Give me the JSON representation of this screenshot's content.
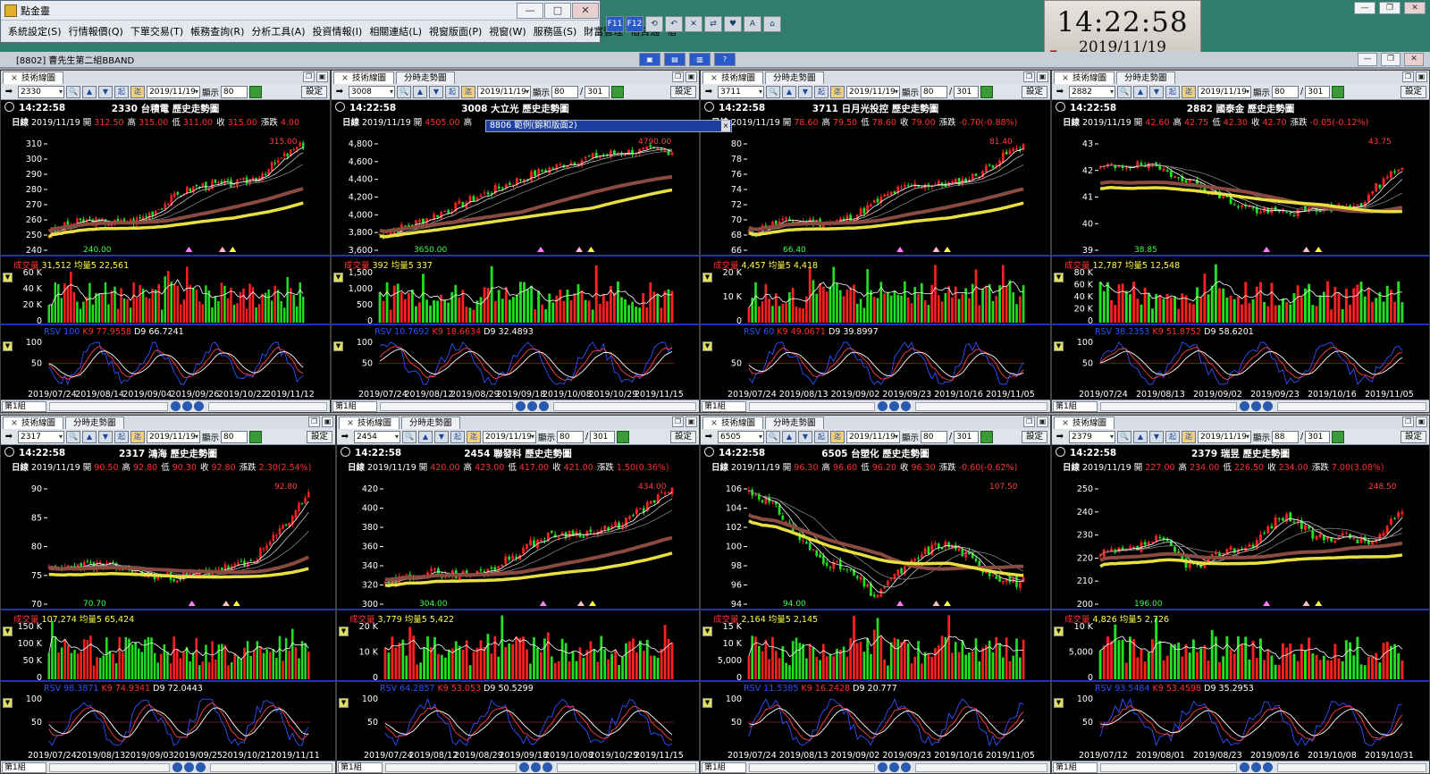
{
  "window": {
    "title": "點金靈",
    "menu": [
      "系統設定(S)",
      "行情報價(Q)",
      "下單交易(T)",
      "帳務查詢(R)",
      "分析工具(A)",
      "投資情報(I)",
      "相關連結(L)",
      "視窗版面(P)",
      "視窗(W)",
      "服務區(S)",
      "財富管理",
      "借貸通",
      "借"
    ],
    "subtitle": "[8802] 曹先生第二組BBAND",
    "toolbar_icons": [
      "F11",
      "F12"
    ],
    "layout_icons": [
      "layout-a",
      "layout-b",
      "layout-c",
      "help"
    ]
  },
  "clock": {
    "time": "14:22:58",
    "date": "2019/11/19"
  },
  "popup": {
    "text": "8806 範例(錦和版面2)"
  },
  "panels": [
    {
      "tab1": "技術線圖",
      "tab2": "",
      "code": "2330",
      "date": "2019/11/19",
      "display_label": "顯示",
      "display": "80",
      "total": "",
      "set": "設定",
      "time": "14:22:58",
      "name": "2330 台積電  歷史走勢圖",
      "dline": {
        "k": "日線",
        "date": "2019/11/19",
        "open_lbl": "開",
        "open": "312.50",
        "high_lbl": "高",
        "high": "315.00",
        "low_lbl": "低",
        "low": "311.00",
        "close_lbl": "收",
        "close": "315.00",
        "chg_lbl": "漲跌",
        "chg": "4.00"
      },
      "price_ticks": [
        "310",
        "300",
        "290",
        "280",
        "270",
        "260",
        "250",
        "240"
      ],
      "price_range": [
        238,
        315
      ],
      "lo_label": "240.00",
      "hi_label": "315.00",
      "vol": {
        "lbl": "成交量",
        "v": "31,512",
        "avg_lbl": "均量5",
        "avg": "22,561",
        "ticks": [
          "60 K",
          "40 K",
          "20 K",
          "0"
        ]
      },
      "kd": {
        "rsv_lbl": "RSV",
        "rsv": "100",
        "k_lbl": "K9",
        "k": "77.9558",
        "d_lbl": "D9",
        "d": "66.7241",
        "ticks": [
          "100",
          "50"
        ]
      },
      "dates": [
        "2019/07/24",
        "2019/08/14",
        "2019/09/04",
        "2019/09/26",
        "2019/10/22",
        "2019/11/12"
      ],
      "group": "第1組",
      "trend": 1,
      "seed": 3
    },
    {
      "tab1": "技術線圖",
      "tab2": "分時走勢圖",
      "code": "3008",
      "date": "2019/11/19",
      "display_label": "顯示",
      "display": "80",
      "total": "301",
      "set": "設定",
      "time": "14:22:58",
      "name": "3008 大立光  歷史走勢圖",
      "dline": {
        "k": "日線",
        "date": "2019/11/19",
        "open_lbl": "開",
        "open": "4505.00",
        "high_lbl": "高",
        "high": "",
        "low_lbl": "",
        "low": "",
        "close_lbl": "",
        "close": "",
        "chg_lbl": "",
        "chg": ""
      },
      "price_ticks": [
        "4,800",
        "4,600",
        "4,400",
        "4,200",
        "4,000",
        "3,800",
        "3,600"
      ],
      "price_range": [
        3600,
        4800
      ],
      "lo_label": "3650.00",
      "hi_label": "4790.00",
      "vol": {
        "lbl": "成交量",
        "v": "392",
        "avg_lbl": "均量5",
        "avg": "337",
        "ticks": [
          "1,500",
          "1,000",
          "500",
          "0"
        ]
      },
      "kd": {
        "rsv_lbl": "RSV",
        "rsv": "10.7692",
        "k_lbl": "K9",
        "k": "18.6634",
        "d_lbl": "D9",
        "d": "32.4893",
        "ticks": [
          "100",
          "50"
        ]
      },
      "dates": [
        "2019/07/24",
        "2019/08/12",
        "2019/08/29",
        "2019/09/18",
        "2019/10/08",
        "2019/10/29",
        "2019/11/15"
      ],
      "group": "第1組",
      "trend": 2,
      "seed": 7
    },
    {
      "tab1": "技術線圖",
      "tab2": "分時走勢圖",
      "code": "3711",
      "date": "2019/11/19",
      "display_label": "顯示",
      "display": "80",
      "total": "301",
      "set": "設定",
      "time": "14:22:58",
      "name": "3711 日月光投控  歷史走勢圖",
      "dline": {
        "k": "日線",
        "date": "2019/11/19",
        "open_lbl": "開",
        "open": "78.60",
        "high_lbl": "高",
        "high": "79.50",
        "low_lbl": "低",
        "low": "78.60",
        "close_lbl": "收",
        "close": "79.00",
        "chg_lbl": "漲跌",
        "chg": "-0.70(-0.88%)"
      },
      "price_ticks": [
        "80",
        "78",
        "76",
        "74",
        "72",
        "70",
        "68",
        "66"
      ],
      "price_range": [
        65.5,
        81.5
      ],
      "lo_label": "66.40",
      "hi_label": "81.40",
      "vol": {
        "lbl": "成交量",
        "v": "4,457",
        "avg_lbl": "均量5",
        "avg": "4,418",
        "ticks": [
          "20 K",
          "10 K",
          "0"
        ]
      },
      "kd": {
        "rsv_lbl": "RSV",
        "rsv": "60",
        "k_lbl": "K9",
        "k": "49.0671",
        "d_lbl": "D9",
        "d": "39.8997",
        "ticks": [
          "50"
        ]
      },
      "dates": [
        "2019/07/24",
        "2019/08/13",
        "2019/09/02",
        "2019/09/23",
        "2019/10/16",
        "2019/11/05"
      ],
      "group": "第1組",
      "trend": 1,
      "seed": 11
    },
    {
      "tab1": "技術線圖",
      "tab2": "分時走勢圖",
      "code": "2882",
      "date": "2019/11/19",
      "display_label": "顯示",
      "display": "80",
      "total": "301",
      "set": "設定",
      "time": "14:22:58",
      "name": "2882 國泰金  歷史走勢圖",
      "dline": {
        "k": "日線",
        "date": "2019/11/19",
        "open_lbl": "開",
        "open": "42.60",
        "high_lbl": "高",
        "high": "42.75",
        "low_lbl": "低",
        "low": "42.30",
        "close_lbl": "收",
        "close": "42.70",
        "chg_lbl": "漲跌",
        "chg": "-0.05(-0.12%)"
      },
      "price_ticks": [
        "43",
        "42",
        "41",
        "40",
        "39"
      ],
      "price_range": [
        38.6,
        43.9
      ],
      "lo_label": "38.85",
      "hi_label": "43.75",
      "vol": {
        "lbl": "成交量",
        "v": "12,787",
        "avg_lbl": "均量5",
        "avg": "12,548",
        "ticks": [
          "80 K",
          "60 K",
          "40 K",
          "20 K",
          "0"
        ]
      },
      "kd": {
        "rsv_lbl": "RSV",
        "rsv": "38.2353",
        "k_lbl": "K9",
        "k": "51.8752",
        "d_lbl": "D9",
        "d": "58.6201",
        "ticks": [
          "100",
          "50"
        ]
      },
      "dates": [
        "2019/07/24",
        "2019/08/13",
        "2019/09/02",
        "2019/09/23",
        "2019/10/16",
        "2019/11/05"
      ],
      "group": "第1組",
      "trend": 3,
      "seed": 19
    },
    {
      "tab1": "技術線圖",
      "tab2": "分時走勢圖",
      "code": "2317",
      "date": "2019/11/19",
      "display_label": "顯示",
      "display": "80",
      "total": "",
      "set": "設定",
      "time": "14:22:58",
      "name": "2317 鴻海  歷史走勢圖",
      "dline": {
        "k": "日線",
        "date": "2019/11/19",
        "open_lbl": "開",
        "open": "90.50",
        "high_lbl": "高",
        "high": "92.80",
        "low_lbl": "低",
        "low": "90.30",
        "close_lbl": "收",
        "close": "92.80",
        "chg_lbl": "漲跌",
        "chg": "2.30(2.54%)"
      },
      "price_ticks": [
        "90",
        "85",
        "80",
        "75",
        "70"
      ],
      "price_range": [
        69,
        94
      ],
      "lo_label": "70.70",
      "hi_label": "92.80",
      "vol": {
        "lbl": "成交量",
        "v": "107,274",
        "avg_lbl": "均量5",
        "avg": "65,424",
        "ticks": [
          "150 K",
          "100 K",
          "50 K",
          "0"
        ]
      },
      "kd": {
        "rsv_lbl": "RSV",
        "rsv": "98.3871",
        "k_lbl": "K9",
        "k": "74.9341",
        "d_lbl": "D9",
        "d": "72.0443",
        "ticks": [
          "100",
          "50"
        ]
      },
      "dates": [
        "2019/07/24",
        "2019/08/13",
        "2019/09/03",
        "2019/09/25",
        "2019/10/21",
        "2019/11/11"
      ],
      "group": "第1組",
      "trend": 4,
      "seed": 23
    },
    {
      "tab1": "技術線圖",
      "tab2": "分時走勢圖",
      "code": "2454",
      "date": "2019/11/19",
      "display_label": "顯示",
      "display": "80",
      "total": "301",
      "set": "設定",
      "time": "14:22:58",
      "name": "2454 聯發科  歷史走勢圖",
      "dline": {
        "k": "日線",
        "date": "2019/11/19",
        "open_lbl": "開",
        "open": "420.00",
        "high_lbl": "高",
        "high": "423.00",
        "low_lbl": "低",
        "low": "417.00",
        "close_lbl": "收",
        "close": "421.00",
        "chg_lbl": "漲跌",
        "chg": "1.50(0.36%)"
      },
      "price_ticks": [
        "420",
        "400",
        "380",
        "360",
        "340",
        "320",
        "300"
      ],
      "price_range": [
        298,
        438
      ],
      "lo_label": "304.00",
      "hi_label": "434.00",
      "vol": {
        "lbl": "成交量",
        "v": "3,779",
        "avg_lbl": "均量5",
        "avg": "5,422",
        "ticks": [
          "20 K",
          "10 K",
          "0"
        ]
      },
      "kd": {
        "rsv_lbl": "RSV",
        "rsv": "64.2857",
        "k_lbl": "K9",
        "k": "53.053",
        "d_lbl": "D9",
        "d": "50.5299",
        "ticks": [
          "100",
          "50"
        ]
      },
      "dates": [
        "2019/07/24",
        "2019/08/12",
        "2019/08/29",
        "2019/09/18",
        "2019/10/08",
        "2019/10/29",
        "2019/11/15"
      ],
      "group": "第1組",
      "trend": 1,
      "seed": 29
    },
    {
      "tab1": "技術線圖",
      "tab2": "分時走勢圖",
      "code": "6505",
      "date": "2019/11/19",
      "display_label": "顯示",
      "display": "80",
      "total": "301",
      "set": "設定",
      "time": "14:22:58",
      "name": "6505 台塑化  歷史走勢圖",
      "dline": {
        "k": "日線",
        "date": "2019/11/19",
        "open_lbl": "開",
        "open": "96.30",
        "high_lbl": "高",
        "high": "96.60",
        "low_lbl": "低",
        "low": "96.20",
        "close_lbl": "收",
        "close": "96.30",
        "chg_lbl": "漲跌",
        "chg": "-0.60(-0.62%)"
      },
      "price_ticks": [
        "106",
        "104",
        "102",
        "100",
        "98",
        "96",
        "94"
      ],
      "price_range": [
        93.5,
        108
      ],
      "lo_label": "94.00",
      "hi_label": "107.50",
      "vol": {
        "lbl": "成交量",
        "v": "2,164",
        "avg_lbl": "均量5",
        "avg": "2,145",
        "ticks": [
          "15 K",
          "10 K",
          "5,000",
          "0"
        ]
      },
      "kd": {
        "rsv_lbl": "RSV",
        "rsv": "11.5385",
        "k_lbl": "K9",
        "k": "16.2428",
        "d_lbl": "D9",
        "d": "20.777",
        "ticks": [
          "100",
          "50"
        ]
      },
      "dates": [
        "2019/07/24",
        "2019/08/13",
        "2019/09/02",
        "2019/09/23",
        "2019/10/16",
        "2019/11/05"
      ],
      "group": "第1組",
      "trend": 5,
      "seed": 31
    },
    {
      "tab1": "技術線圖",
      "tab2": "",
      "code": "2379",
      "date": "2019/11/19",
      "display_label": "顯示",
      "display": "88",
      "total": "301",
      "set": "設定",
      "time": "14:22:58",
      "name": "2379 瑞昱  歷史走勢圖",
      "dline": {
        "k": "日線",
        "date": "2019/11/19",
        "open_lbl": "開",
        "open": "227.00",
        "high_lbl": "高",
        "high": "234.00",
        "low_lbl": "低",
        "low": "226.50",
        "close_lbl": "收",
        "close": "234.00",
        "chg_lbl": "漲跌",
        "chg": "7.00(3.08%)"
      },
      "price_ticks": [
        "250",
        "240",
        "230",
        "220",
        "210",
        "200"
      ],
      "price_range": [
        194,
        251
      ],
      "lo_label": "196.00",
      "hi_label": "248.50",
      "vol": {
        "lbl": "成交量",
        "v": "4,826",
        "avg_lbl": "均量5",
        "avg": "2,726",
        "ticks": [
          "10 K",
          "5,000",
          "0"
        ]
      },
      "kd": {
        "rsv_lbl": "RSV",
        "rsv": "93.5484",
        "k_lbl": "K9",
        "k": "53.4598",
        "d_lbl": "D9",
        "d": "35.2953",
        "ticks": [
          "100",
          "50"
        ]
      },
      "dates": [
        "2019/07/12",
        "2019/08/01",
        "2019/08/23",
        "2019/09/16",
        "2019/10/08",
        "2019/10/31"
      ],
      "group": "第1組",
      "trend": 6,
      "seed": 37
    }
  ],
  "colors": {
    "up": "#ff2020",
    "down": "#20e020",
    "ma_yellow": "#e8e040",
    "ma_brown": "#8a4a40",
    "axis_blue": "#2030c0",
    "k_line": "#3050ff",
    "d_line": "#ff4040"
  }
}
